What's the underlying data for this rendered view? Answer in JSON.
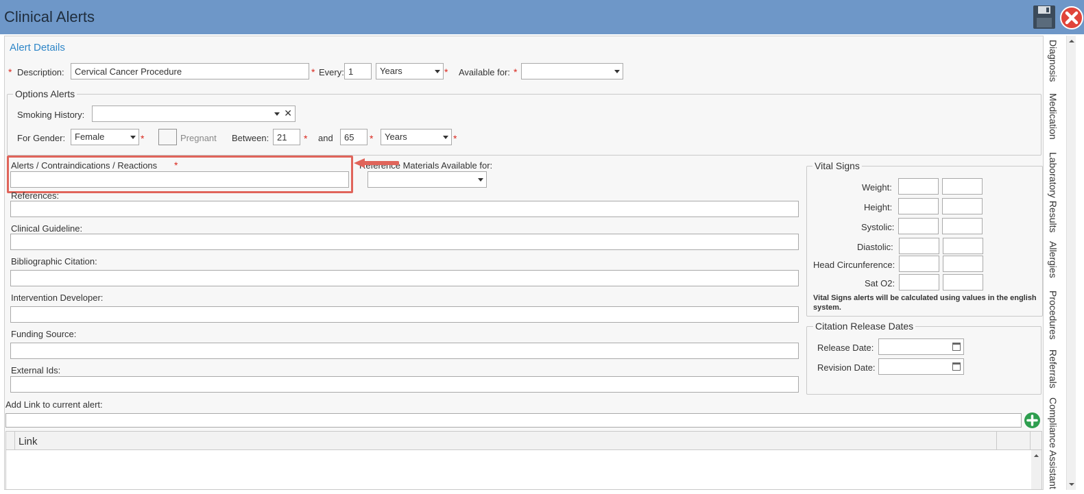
{
  "window": {
    "title": "Clinical Alerts"
  },
  "alert_details": {
    "section_title": "Alert Details",
    "description_label": "Description:",
    "description_value": "Cervical Cancer Procedure",
    "every_label": "Every:",
    "every_value": "1",
    "every_unit": "Years",
    "available_for_label": "Available for:",
    "available_for_value": ""
  },
  "options": {
    "legend": "Options Alerts",
    "smoking_label": "Smoking History:",
    "smoking_value": "",
    "clear_glyph": "✕",
    "gender_label": "For Gender:",
    "gender_value": "Female",
    "pregnant_label": "Pregnant",
    "between_label": "Between:",
    "age_from": "21",
    "and_label": "and",
    "age_to": "65",
    "age_unit": "Years"
  },
  "required_mark": "*",
  "alerts_label": "Alerts / Contraindications / Reactions",
  "alerts_value": "",
  "reference_materials_label": "Reference Materials Available for:",
  "fields": {
    "references": "References:",
    "clinical_guideline": "Clinical Guideline:",
    "bibliographic_citation": "Bibliographic Citation:",
    "intervention_developer": "Intervention Developer:",
    "funding_source": "Funding Source:",
    "external_ids": "External Ids:"
  },
  "vital_signs": {
    "legend": "Vital Signs",
    "rows": [
      "Weight:",
      "Height:",
      "Systolic:",
      "Diastolic:",
      "Head Circunference:",
      "Sat O2:"
    ],
    "note": "Vital Signs alerts will be calculated using values in the english system."
  },
  "citation_dates": {
    "legend": "Citation Release Dates",
    "release_label": "Release Date:",
    "revision_label": "Revision Date:"
  },
  "link": {
    "add_label": "Add Link to current alert:",
    "column_header": "Link"
  },
  "side_tabs": [
    "Diagnosis",
    "Medication",
    "Laboratory Results",
    "Allergies",
    "Procedures",
    "Referrals",
    "Compliance Assistant"
  ],
  "colors": {
    "titlebar": "#6e97c8",
    "accent": "#2e86c8",
    "required": "#d9261c",
    "highlight": "#e0645a",
    "add": "#2e9e4f"
  },
  "icons": {
    "save": "floppy-disk-icon",
    "close": "close-circle-icon",
    "add": "plus-circle-icon",
    "calendar": "calendar-icon"
  }
}
